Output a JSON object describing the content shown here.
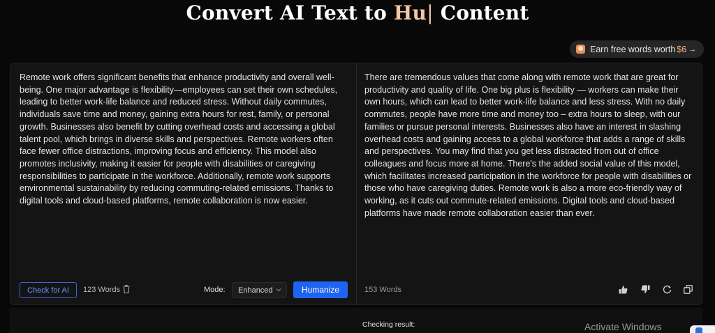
{
  "header": {
    "title_prefix": "Convert AI Text to ",
    "title_accent": "Hu",
    "title_cursor": "|",
    "title_suffix": " Content"
  },
  "promo": {
    "label": "Earn free words worth",
    "amount": "$6",
    "arrow": "→",
    "icon": "gift-icon",
    "accent_color": "#f0b48a"
  },
  "input_panel": {
    "text": "Remote work offers significant benefits that enhance productivity and overall well-being. One major advantage is flexibility—employees can set their own schedules, leading to better work-life balance and reduced stress. Without daily commutes, individuals save time and money, gaining extra hours for rest, family, or personal growth. Businesses also benefit by cutting overhead costs and accessing a global talent pool, which brings in diverse skills and perspectives. Remote workers often face fewer office distractions, improving focus and efficiency. This model also promotes inclusivity, making it easier for people with disabilities or caregiving responsibilities to participate in the workforce. Additionally, remote work supports environmental sustainability by reducing commuting-related emissions. Thanks to digital tools and cloud-based platforms, remote collaboration is now easier.",
    "check_button": "Check for AI",
    "word_count": "123 Words",
    "mode_label": "Mode:",
    "mode_value": "Enhanced",
    "humanize_button": "Humanize",
    "humanize_color": "#1f63f2"
  },
  "output_panel": {
    "text": "There are tremendous values that come along with  remote work that are great for productivity and quality of life. One big plus is flexibility — workers can  make their own hours, which can lead to better work-life balance and less stress. With no daily commutes, people  have more time and money too – extra hours to sleep, with our families or pursue personal interests. Businesses also have an interest in slashing overhead  costs and gaining access to a global workforce that adds a range of skills and perspectives. You may find that you get less distracted from out of office colleagues and  focus more at home. There's the added social value of this model, which facilitates increased  participation in the workforce for people with disabilities or those who have caregiving duties. Remote work is also  a more eco-friendly way of working, as it cuts out commute-related emissions. Digital  tools and cloud-based platforms have made remote collaboration easier than ever.",
    "word_count": "153 Words",
    "actions": [
      "thumbs-up-icon",
      "thumbs-down-icon",
      "refresh-icon",
      "copy-icon"
    ]
  },
  "result": {
    "label": "Checking result:"
  },
  "os_overlay": {
    "watermark": "Activate Windows"
  }
}
